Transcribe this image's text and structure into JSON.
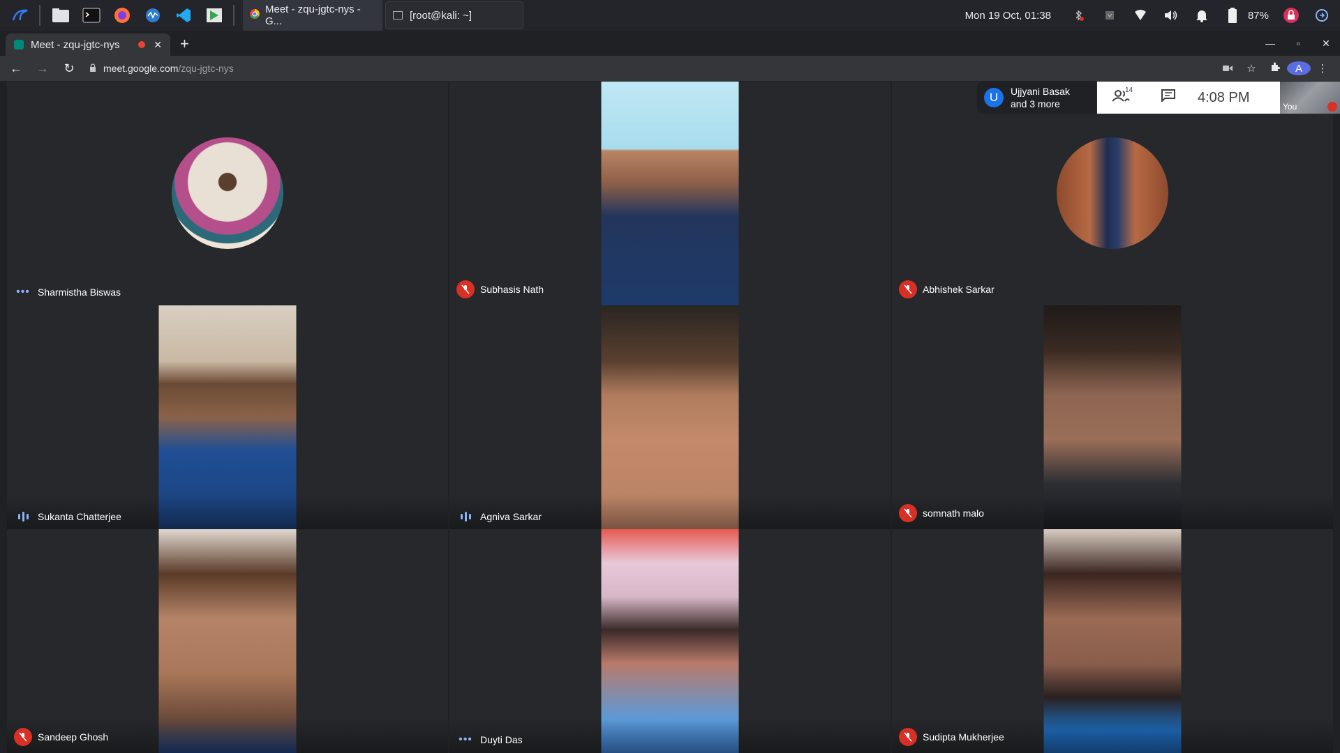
{
  "taskbar": {
    "tasks": [
      "Meet - zqu-jgtc-nys - G...",
      "[root@kali: ~]"
    ],
    "clock": "Mon 19 Oct, 01:38",
    "battery": "87%"
  },
  "browser": {
    "tab_title": "Meet - zqu-jgtc-nys",
    "new_tab": "+",
    "url_host": "meet.google.com",
    "url_path": "/zqu-jgtc-nys",
    "profile_initial": "A"
  },
  "meeting": {
    "joined_initial": "U",
    "joined_line1": "Ujjyani Basak",
    "joined_line2": "and 3 more",
    "participant_count": "14",
    "time": "4:08 PM",
    "self_label": "You"
  },
  "participants": [
    {
      "name": "Sharmistha Biswas",
      "status": "dots",
      "kind": "avatar"
    },
    {
      "name": "Subhasis Nath",
      "status": "muted",
      "kind": "video"
    },
    {
      "name": "Abhishek Sarkar",
      "status": "muted",
      "kind": "avatar"
    },
    {
      "name": "Sukanta Chatterjee",
      "status": "speaking",
      "kind": "video"
    },
    {
      "name": "Agniva Sarkar",
      "status": "speaking",
      "kind": "video"
    },
    {
      "name": "somnath malo",
      "status": "muted",
      "kind": "video"
    },
    {
      "name": "Sandeep Ghosh",
      "status": "muted",
      "kind": "video"
    },
    {
      "name": "Duyti Das",
      "status": "dots",
      "kind": "video"
    },
    {
      "name": "Sudipta Mukherjee",
      "status": "muted",
      "kind": "video"
    }
  ],
  "colors": {
    "background": "#202124",
    "tile": "#26282b",
    "mute_red": "#d93025",
    "accent_blue": "#8ab4f8"
  }
}
